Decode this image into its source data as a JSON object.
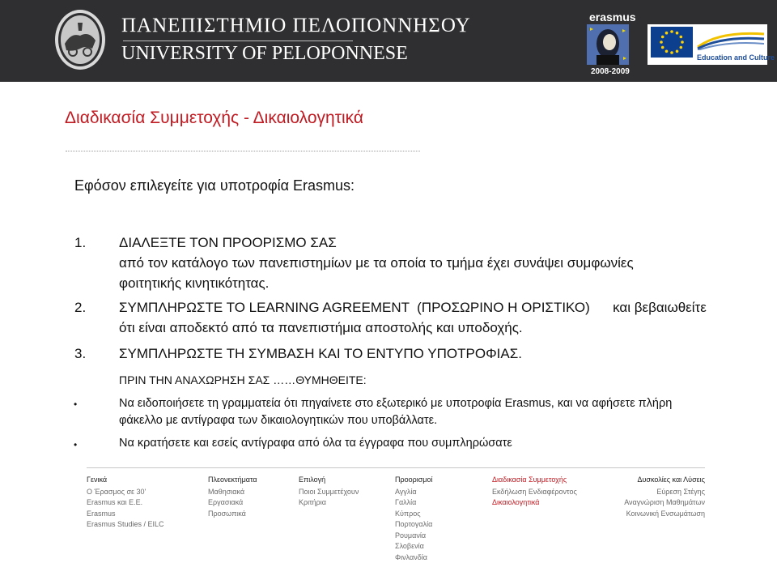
{
  "header": {
    "university_gr": "ΠΑΝΕΠΙΣΤΗΜΙΟ ΠΕΛΟΠΟΝΝΗΣΟΥ",
    "university_en": "UNIVERSITY OF PELOPONNESE",
    "erasmus_label": "erasmus",
    "year": "2008-2009",
    "ec_label": "Education and Culture"
  },
  "main": {
    "title": "Διαδικασία Συμμετοχής - Δικαιολογητικά",
    "intro": "Εφόσον επιλεγείτε για υποτροφία Erasmus:",
    "steps": [
      {
        "num": "1.",
        "lines": [
          "ΔΙΑΛΕΞΤΕ ΤΟΝ ΠΡΟΟΡΙΣΜΟ ΣΑΣ",
          "από τον κατάλογο των πανεπιστημίων με τα οποία το τμήμα έχει συνάψει συμφωνίες",
          "φοιτητικής κινητικότητας."
        ]
      },
      {
        "num": "2.",
        "lines": [
          "ΣΥΜΠΛΗΡΩΣΤΕ ΤΟ LEARNING AGREEMENT  (ΠΡΟΣΩΡΙΝΟ Η ΟΡΙΣΤΙΚΟ)      και βεβαιωθείτε",
          "ότι είναι αποδεκτό από τα πανεπιστήμια αποστολής και υποδοχής."
        ]
      },
      {
        "num": "3.",
        "lines": [
          "ΣΥΜΠΛΗΡΩΣΤΕ ΤΗ ΣΥΜΒΑΣΗ ΚΑΙ ΤΟ ΕΝΤΥΠΟ ΥΠΟΤΡΟΦΙΑΣ."
        ]
      }
    ],
    "reminder_heading": "ΠΡΙΝ ΤΗΝ ΑΝΑΧΩΡΗΣΗ ΣΑΣ ……ΘΥΜΗΘΕΙΤΕ:",
    "bullets": [
      {
        "lines": [
          "Να ειδοποιήσετε τη γραμματεία ότι πηγαίνετε στο εξωτερικό με υποτροφία Erasmus, και να αφήσετε πλήρη",
          "φάκελλο με αντίγραφα των  δικαιολογητικών που υποβάλλατε."
        ]
      },
      {
        "lines": [
          "Να κρατήσετε και εσείς αντίγραφα από όλα τα έγγραφα που συμπληρώσατε"
        ]
      }
    ]
  },
  "footer": {
    "columns": [
      {
        "heading": "Γενικά",
        "items": [
          "Ο Έρασμος σε 30'",
          "Erasmus και Ε.Ε.",
          "Erasmus",
          "Erasmus Studies / EILC"
        ]
      },
      {
        "heading": "Πλεονεκτήματα",
        "items": [
          "Μαθησιακά",
          "Εργασιακά",
          "Προσωπικά"
        ]
      },
      {
        "heading": "Επιλογή",
        "items": [
          "Ποιοι Συμμετέχουν",
          "Κριτήρια"
        ]
      },
      {
        "heading": "Προορισμοί",
        "items": [
          "Αγγλία",
          "Γαλλία",
          "Κύπρος",
          "Πορτογαλία",
          "Ρουμανία",
          "Σλοβενία",
          "Φινλανδία"
        ]
      },
      {
        "heading": "Διαδικασία Συμμετοχής",
        "items": [
          "Εκδήλωση Ενδιαφέροντος",
          "Δικαιολογητικά"
        ]
      },
      {
        "heading": "Δυσκολίες και Λύσεις",
        "items": [
          "Εύρεση Στέγης",
          "Αναγνώριση Μαθημάτων",
          "Κοινωνική Ενσωμάτωση"
        ]
      }
    ]
  },
  "colors": {
    "header_bg": "#2f2f31",
    "accent_red": "#c01b22",
    "eu_blue": "#0d3f8f"
  }
}
